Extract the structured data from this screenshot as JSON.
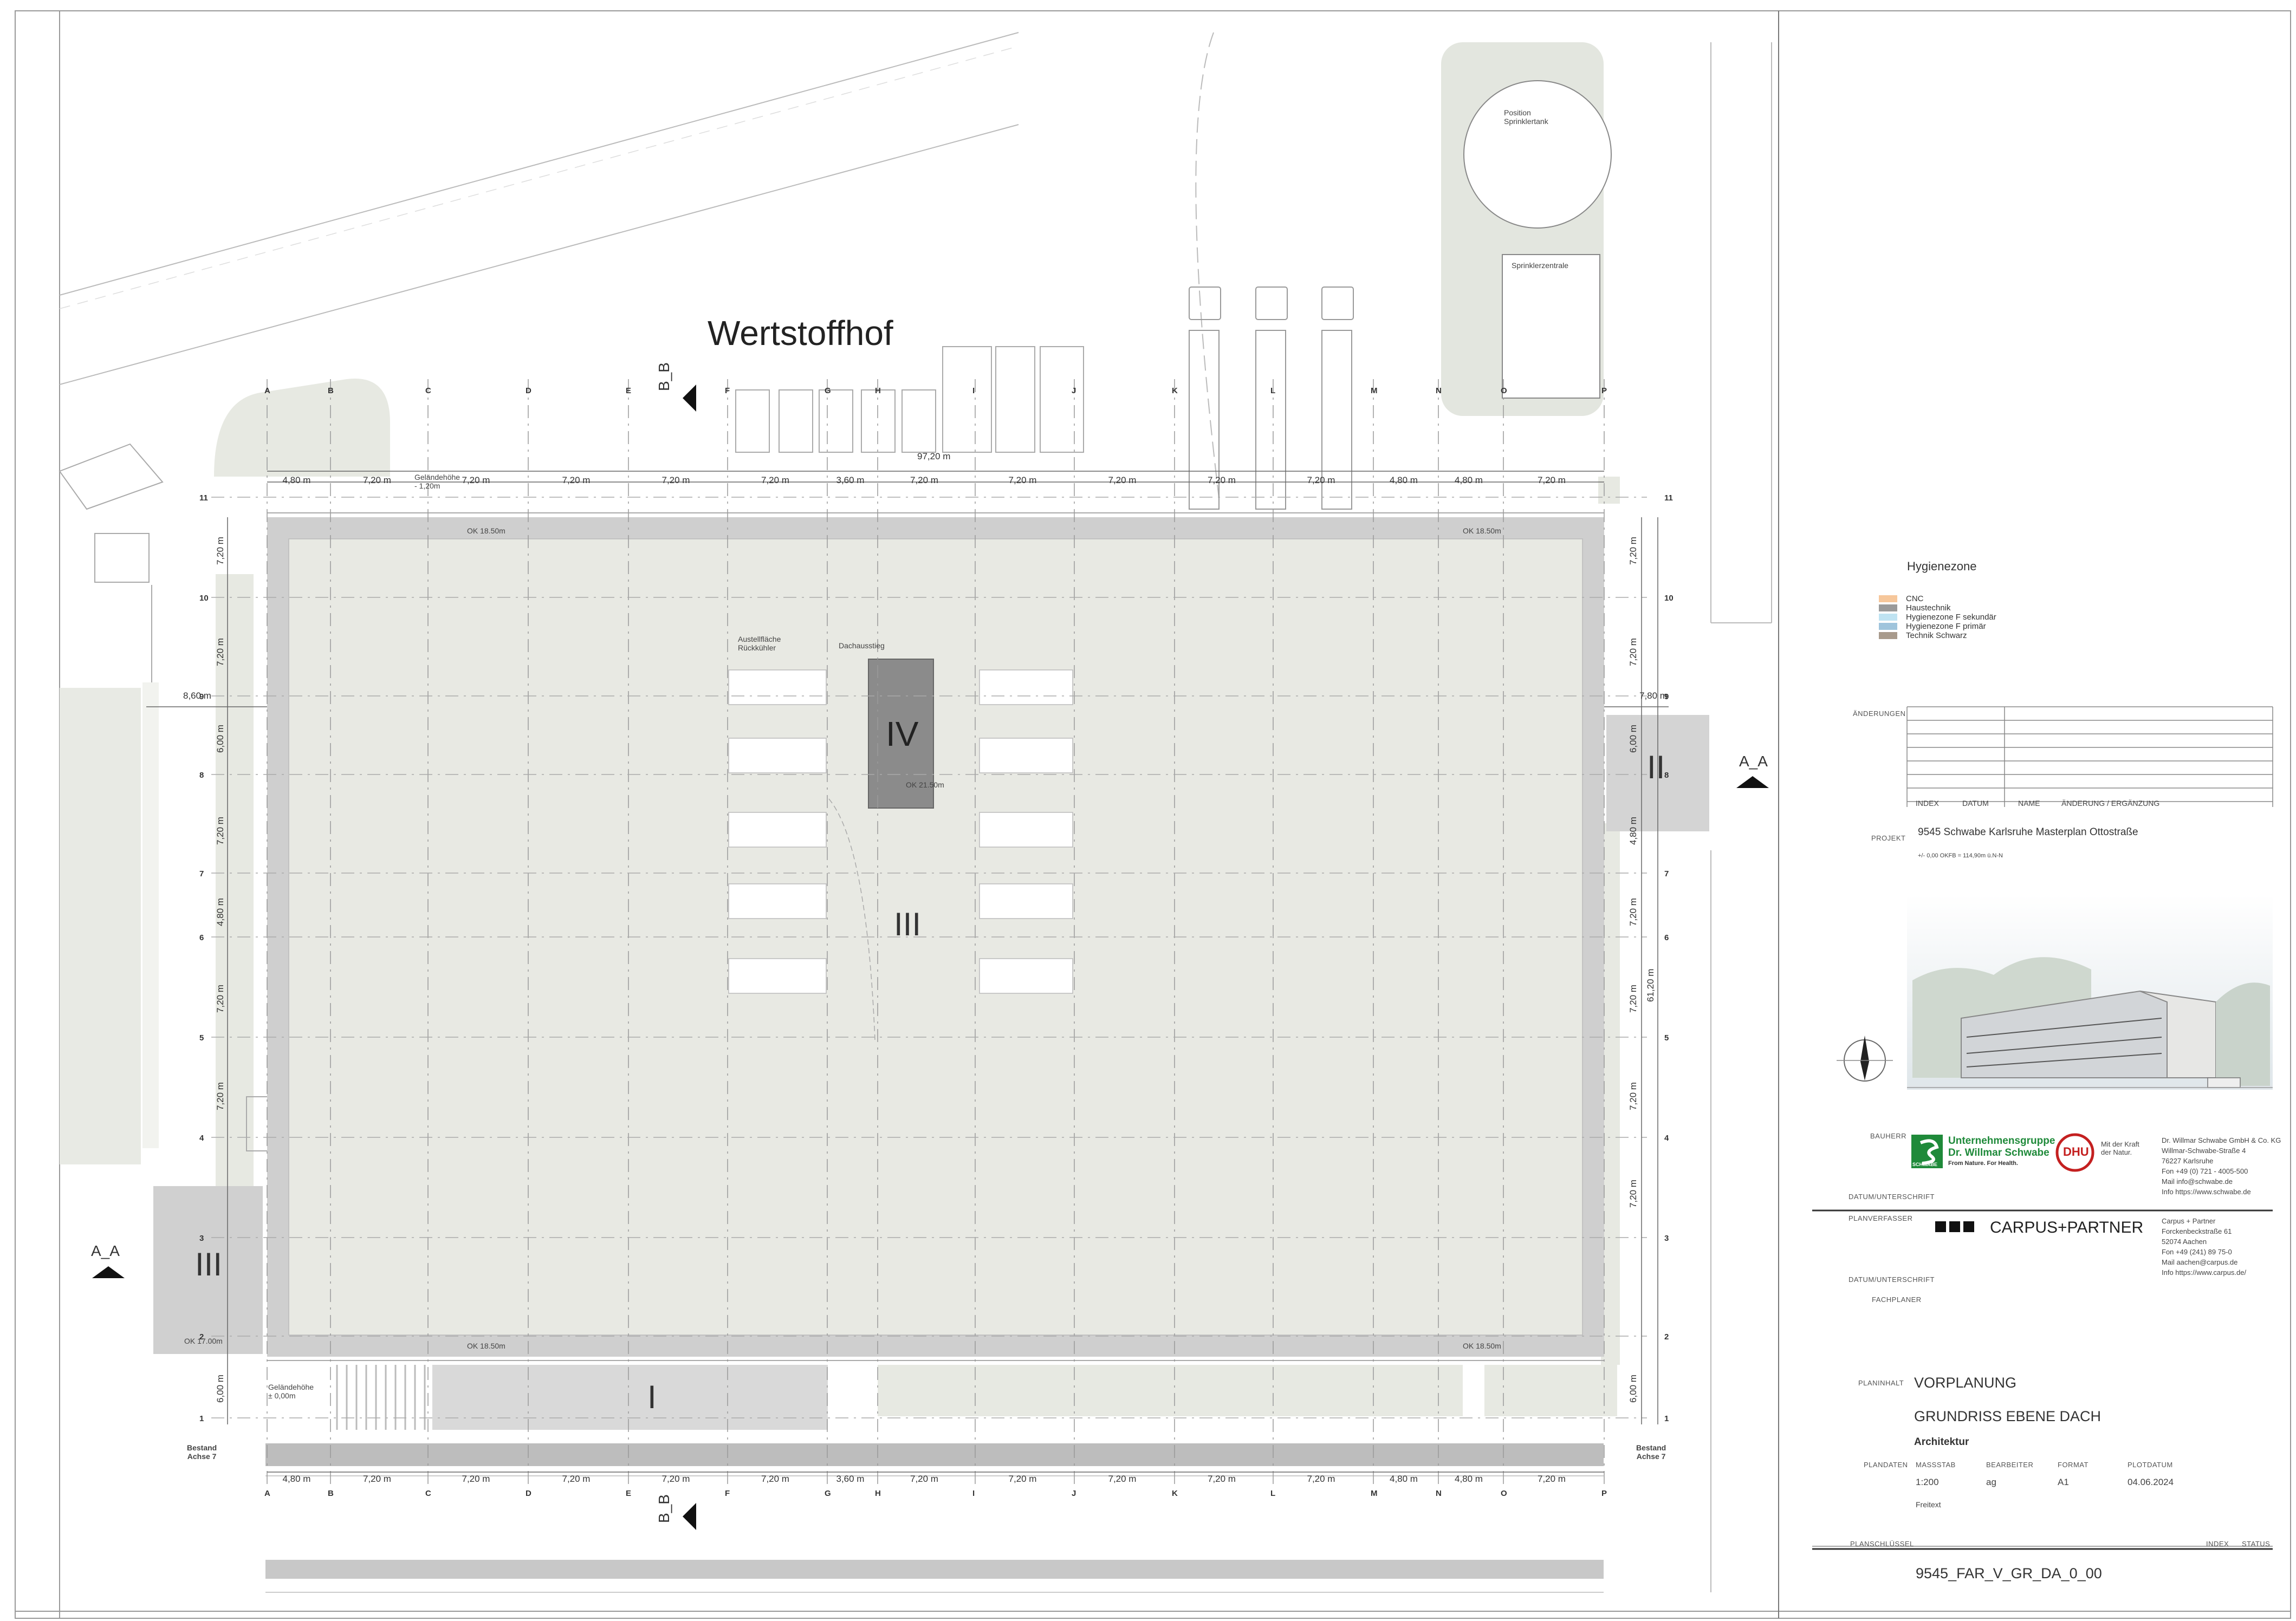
{
  "drawing": {
    "courtyard_label": "Wertstoffhof",
    "grid_columns": [
      "A",
      "B",
      "C",
      "D",
      "E",
      "F",
      "G",
      "H",
      "I",
      "J",
      "K",
      "L",
      "M",
      "N",
      "O",
      "P"
    ],
    "grid_rows": [
      "11",
      "10",
      "9",
      "8",
      "7",
      "6",
      "5",
      "4",
      "3",
      "2",
      "1"
    ],
    "total_width": "97,20 m",
    "bay_widths": [
      "4,80 m",
      "7,20 m",
      "7,20 m",
      "7,20 m",
      "7,20 m",
      "7,20 m",
      "3,60 m",
      "7,20 m",
      "7,20 m",
      "7,20 m",
      "7,20 m",
      "7,20 m",
      "4,80 m",
      "4,80 m",
      "7,20 m"
    ],
    "left_dims": [
      "7,20 m",
      "7,20 m",
      "6,00 m",
      "7,20 m",
      "4,80 m",
      "7,20 m",
      "7,20 m",
      "6,00 m"
    ],
    "right_dims": [
      "7,20 m",
      "7,20 m",
      "6,00 m",
      "4,80 m",
      "7,20 m",
      "7,20 m",
      "7,20 m",
      "7,20 m",
      "6,00 m"
    ],
    "right_total": "61,20 m",
    "left_extra": "8,60 m",
    "right_extra": "7,80 m",
    "ground_top": "Geländehöhe\n- 1,20m",
    "ground_bottom": "Geländehöhe\n± 0,00m",
    "ok_roof": "OK 18.50m",
    "ok_core": "OK 21.50m",
    "ok_block3": "OK 17.00m",
    "zone_1": "I",
    "zone_2": "II",
    "zone_3": "III",
    "zone_4": "IV",
    "cooler_area": "Austellfläche\nRückkühler",
    "roof_access": "Dachausstieg",
    "sprinkler_tank": "Position\nSprinklertank",
    "sprinkler_central": "Sprinklerzentrale",
    "section_aa": "A_A",
    "section_bb": "B_B",
    "existing_axis": "Bestand\nAchse 7"
  },
  "legend": {
    "title": "Hygienezone",
    "items": [
      {
        "label": "CNC",
        "color": "#f6c79b"
      },
      {
        "label": "Haustechnik",
        "color": "#9a9a9a"
      },
      {
        "label": "Hygienezone F sekundär",
        "color": "#bfe3f2"
      },
      {
        "label": "Hygienezone F primär",
        "color": "#9fc4dc"
      },
      {
        "label": "Technik Schwarz",
        "color": "#a89a8c"
      }
    ]
  },
  "title_block": {
    "changes_label": "ÄNDERUNGEN",
    "changes_cols": [
      "INDEX",
      "DATUM",
      "NAME",
      "ÄNDERUNG / ERGÄNZUNG"
    ],
    "project_label": "PROJEKT",
    "project_name": "9545 Schwabe Karlsruhe Masterplan Ottostraße",
    "project_level": "+/- 0,00 OKFB = 114,90m ü.N-N",
    "client_label": "BAUHERR",
    "client_logo_line1": "Unternehmensgruppe",
    "client_logo_line2": "Dr. Willmar Schwabe",
    "client_logo_tag": "From Nature. For Health.",
    "client_logo_short": "SCHWABE",
    "dhu_mark": "DHU",
    "dhu_tag": "Mit der Kraft\nder Natur.",
    "client_address": [
      "Dr. Willmar Schwabe GmbH & Co. KG",
      "Willmar-Schwabe-Straße 4",
      "76227 Karlsruhe",
      "Fon +49 (0) 721 - 4005-500",
      "Mail info@schwabe.de",
      "Info https://www.schwabe.de"
    ],
    "signature_label": "DATUM/UNTERSCHRIFT",
    "designer_label": "PLANVERFASSER",
    "designer_logo": "CARPUS+PARTNER",
    "designer_address": [
      "Carpus + Partner",
      "Forckenbeckstraße 61",
      "52074 Aachen",
      "Fon +49 (241) 89 75-0",
      "Mail aachen@carpus.de",
      "Info https://www.carpus.de/"
    ],
    "signature_label_2": "DATUM/UNTERSCHRIFT",
    "specialist_label": "FACHPLANER",
    "content_label": "PLANINHALT",
    "phase": "VORPLANUNG",
    "plan_title": "GRUNDRISS EBENE DACH",
    "discipline": "Architektur",
    "data_label": "PLANDATEN",
    "data_cols": [
      "MASSSTAB",
      "BEARBEITER",
      "FORMAT",
      "PLOTDATUM"
    ],
    "data_vals": [
      "1:200",
      "ag",
      "A1",
      "04.06.2024"
    ],
    "freetext": "Freitext",
    "key_label": "PLANSCHLÜSSEL",
    "index_label": "INDEX",
    "status_label": "STATUS",
    "plan_key": "9545_FAR_V_GR_DA_0_00"
  }
}
